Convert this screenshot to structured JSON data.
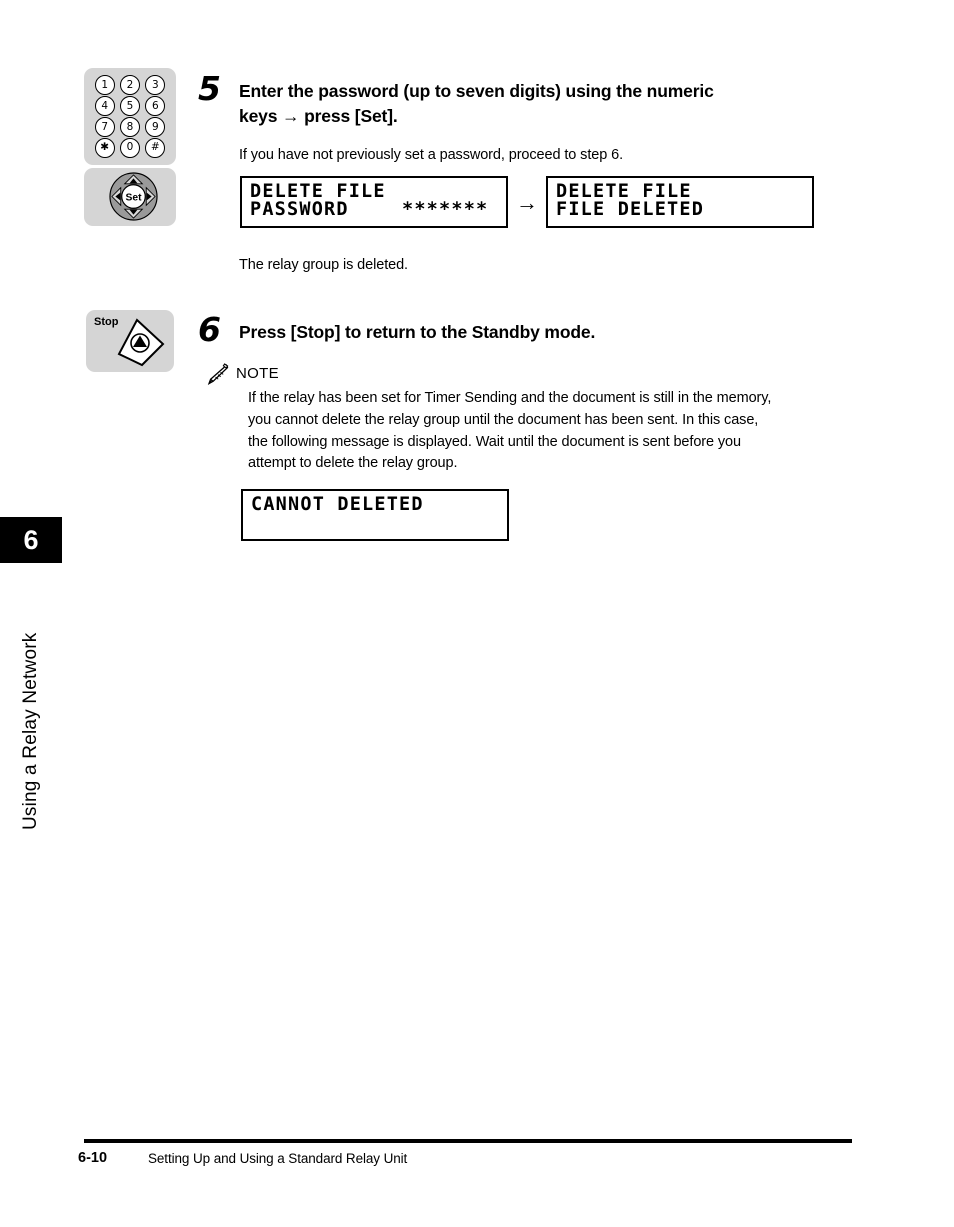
{
  "page": {
    "chapter_number": "6",
    "chapter_title": "Using a Relay Network",
    "footer_page": "6-10",
    "footer_title": "Setting Up and Using a Standard Relay Unit"
  },
  "steps": [
    {
      "number": "5",
      "title_line1": "Enter the password (up to seven digits) using the numeric",
      "title_line2": "keys → press [Set].",
      "body": "If you have not previously set a password, proceed to step 6.",
      "result": "The relay group is deleted."
    },
    {
      "number": "6",
      "title": "Press [Stop] to return to the Standby mode."
    }
  ],
  "keypad": {
    "keys": [
      "1",
      "2",
      "3",
      "4",
      "5",
      "6",
      "7",
      "8",
      "9",
      "✱",
      "0",
      "#"
    ]
  },
  "setpad": {
    "label": "Set"
  },
  "stoppad": {
    "label": "Stop"
  },
  "lcd_displays": [
    {
      "id": "password-prompt",
      "line1": "DELETE FILE",
      "line2": "PASSWORD",
      "line2_right": "*******"
    },
    {
      "id": "file-deleted",
      "line1": "DELETE FILE",
      "line2": "FILE DELETED"
    },
    {
      "id": "cannot-deleted",
      "line1": "CANNOT DELETED",
      "line2": ""
    }
  ],
  "arrow": "→",
  "note": {
    "label": "NOTE",
    "lines": [
      "If the relay has been set for Timer Sending and the document is still in the memory,",
      "you cannot delete the relay group until the document has been sent. In this case,",
      "the following message is displayed. Wait until the document is sent before you",
      "attempt to delete the relay group."
    ]
  }
}
